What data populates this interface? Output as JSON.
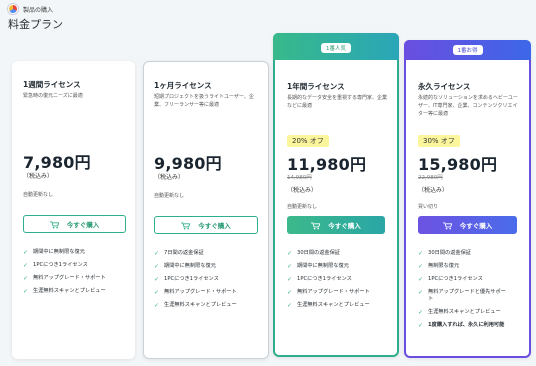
{
  "header": {
    "breadcrumb": "製品の購入",
    "title": "料金プラン"
  },
  "plans": [
    {
      "name": "1週間ライセンス",
      "desc": "緊急時の復元ニーズに最適",
      "price": "7,980円",
      "tax": "（税込み）",
      "renew": "自動更新なし",
      "buy_label": "今すぐ購入",
      "features": [
        "期間中に無制限な復元",
        "1PCにつき1ライセンス",
        "無料アップグレード・サポート",
        "生涯無料スキャンとプレビュー"
      ]
    },
    {
      "name": "1ヶ月ライセンス",
      "desc": "短期プロジェクトを扱うライトユーザー、企業、フリーランサー等に最適",
      "price": "9,980円",
      "tax": "（税込み）",
      "renew": "自動更新なし",
      "buy_label": "今すぐ購入",
      "features": [
        "7日間の返金保証",
        "期間中に無制限な復元",
        "1PCにつき1ライセンス",
        "無料アップグレード・サポート",
        "生涯無料スキャンとプレビュー"
      ]
    },
    {
      "badge": "1番人気",
      "name": "1年間ライセンス",
      "desc": "長期的なデータ安全を重視する専門家、企業などに最適",
      "discount": "20% オフ",
      "price": "11,980円",
      "old_price": "14,980円",
      "tax": "（税込み）",
      "renew": "自動更新なし",
      "buy_label": "今すぐ購入",
      "features": [
        "30日間の返金保証",
        "期間中に無制限な復元",
        "1PCにつき1ライセンス",
        "無料アップグレード・サポート",
        "生涯無料スキャンとプレビュー"
      ]
    },
    {
      "badge": "1番お得",
      "name": "永久ライセンス",
      "desc": "永続的なソリューションを求めるヘビーユーザー、IT専門家、企業、コンテンツクリエイター等に最適",
      "discount": "30% オフ",
      "price": "15,980円",
      "old_price": "22,980円",
      "tax": "（税込み）",
      "renew": "買い切り",
      "buy_label": "今すぐ購入",
      "features": [
        "30日間の返金保証",
        "無制限な復元",
        "1PCにつき1ライセンス",
        "無料アップグレードと優先サポート",
        "生涯無料スキャンとプレビュー",
        "1度購入すれば、永久に利用可能"
      ]
    }
  ]
}
